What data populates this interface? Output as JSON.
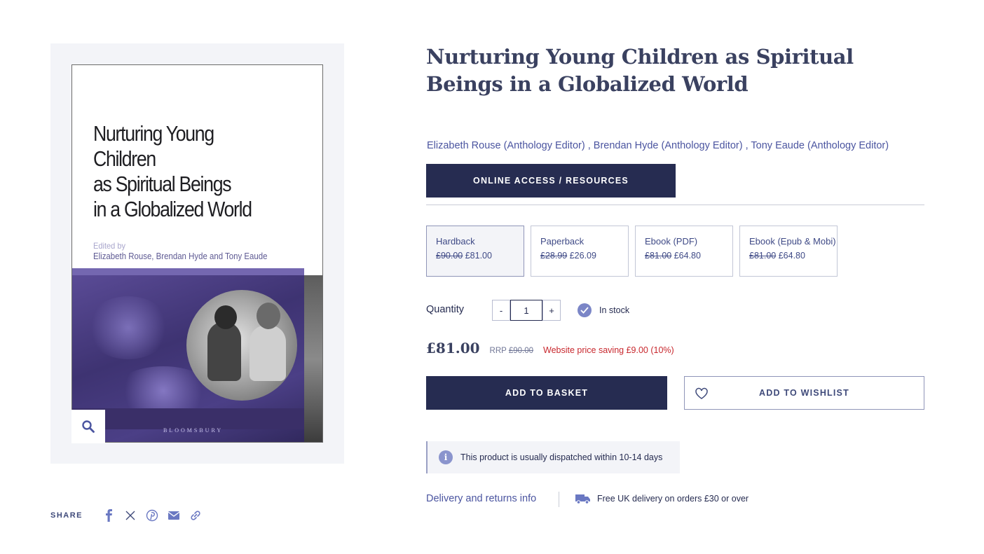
{
  "product": {
    "title": "Nurturing Young Children as Spiritual Beings in a Globalized World",
    "authors": [
      "Elizabeth Rouse (Anthology Editor)",
      "Brendan Hyde (Anthology Editor)",
      "Tony Eaude (Anthology Editor)"
    ],
    "author_separator": " , "
  },
  "cover": {
    "title_lines": [
      "Nurturing Young Children",
      "as Spiritual Beings",
      "in a Globalized World"
    ],
    "edited_by": "Edited by",
    "editors": "Elizabeth Rouse, Brendan Hyde and Tony Eaude",
    "publisher": "BLOOMSBURY",
    "accent_color": "#7467b0"
  },
  "zoom": {
    "icon": "search-icon"
  },
  "share": {
    "label": "SHARE",
    "icons": [
      "facebook-icon",
      "x-icon",
      "pinterest-icon",
      "email-icon",
      "link-icon"
    ]
  },
  "online_access": {
    "label": "ONLINE ACCESS / RESOURCES"
  },
  "formats": [
    {
      "name": "Hardback",
      "old_price": "£90.00",
      "price": "£81.00",
      "selected": true
    },
    {
      "name": "Paperback",
      "old_price": "£28.99",
      "price": "£26.09",
      "selected": false
    },
    {
      "name": "Ebook (PDF)",
      "old_price": "£81.00",
      "price": "£64.80",
      "selected": false
    },
    {
      "name": "Ebook (Epub & Mobi)",
      "old_price": "£81.00",
      "price": "£64.80",
      "selected": false
    }
  ],
  "quantity": {
    "label": "Quantity",
    "value": "1",
    "minus": "-",
    "plus": "+"
  },
  "stock": {
    "label": "In stock"
  },
  "pricing": {
    "price": "£81.00",
    "rrp_label": "RRP",
    "rrp_value": "£90.00",
    "saving": "Website price saving £9.00 (10%)"
  },
  "actions": {
    "basket": "ADD TO BASKET",
    "wishlist": "ADD TO WISHLIST"
  },
  "notice": {
    "text": "This product is usually dispatched within 10-14 days",
    "icon": "i"
  },
  "delivery": {
    "link": "Delivery and returns info",
    "free": "Free UK delivery on orders £30 or over"
  },
  "colors": {
    "navy": "#262c51",
    "link": "#4b55a0",
    "sale": "#c8282e",
    "accent": "#7b86c7"
  }
}
